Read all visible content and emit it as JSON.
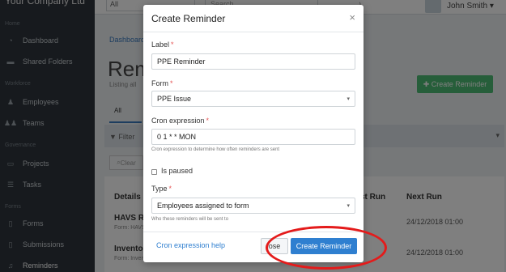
{
  "sidebar": {
    "brand": "Your Company Ltd",
    "sections": {
      "home": "Home",
      "workforce": "Workforce",
      "governance": "Governance",
      "forms": "Forms"
    },
    "items": [
      {
        "label": "Dashboard",
        "icon": "dashboard-icon"
      },
      {
        "label": "Shared Folders",
        "icon": "folder-icon"
      },
      {
        "label": "Employees",
        "icon": "user-icon"
      },
      {
        "label": "Teams",
        "icon": "users-icon"
      },
      {
        "label": "Projects",
        "icon": "folder-icon"
      },
      {
        "label": "Tasks",
        "icon": "tasks-icon"
      },
      {
        "label": "Forms",
        "icon": "file-icon"
      },
      {
        "label": "Submissions",
        "icon": "file-icon"
      },
      {
        "label": "Reminders",
        "icon": "bell-icon"
      }
    ]
  },
  "topbar": {
    "company_select": "All",
    "search_placeholder": "Search",
    "user_name": "John Smith"
  },
  "page": {
    "breadcrumb": "Dashboard",
    "title": "Rem",
    "subtitle": "Listing all",
    "create_button": "Create Reminder",
    "tab_all": "All",
    "filter": "Filter",
    "clear": "Clear",
    "table": {
      "headers": {
        "details": "Details",
        "last_run": "st Run",
        "next_run": "Next Run"
      },
      "rows": [
        {
          "name": "HAVS Re",
          "sub": "Form: HAVS",
          "next_run": "24/12/2018 01:00"
        },
        {
          "name": "Inventory",
          "sub": "Form: Inven",
          "next_run": "24/12/2018 01:00"
        }
      ]
    }
  },
  "modal": {
    "title": "Create Reminder",
    "close_icon": "×",
    "label_label": "Label",
    "label_value": "PPE Reminder",
    "form_label": "Form",
    "form_value": "PPE Issue",
    "cron_label": "Cron expression",
    "cron_value": "0 1 * * MON",
    "cron_help": "Cron expression to determine how often reminders are sent",
    "paused_label": "Is paused",
    "paused_checked": false,
    "type_label": "Type",
    "type_value": "Employees assigned to form",
    "type_help": "Who these reminders will be sent to",
    "required_mark": "*",
    "cron_help_link": "Cron expression help",
    "close_button": "ose",
    "create_button": "Create Reminder"
  },
  "colors": {
    "primary": "#2f7fd0",
    "success": "#4dbd74",
    "sidebar": "#2f353c",
    "annotation_ring": "#e41b1b"
  }
}
